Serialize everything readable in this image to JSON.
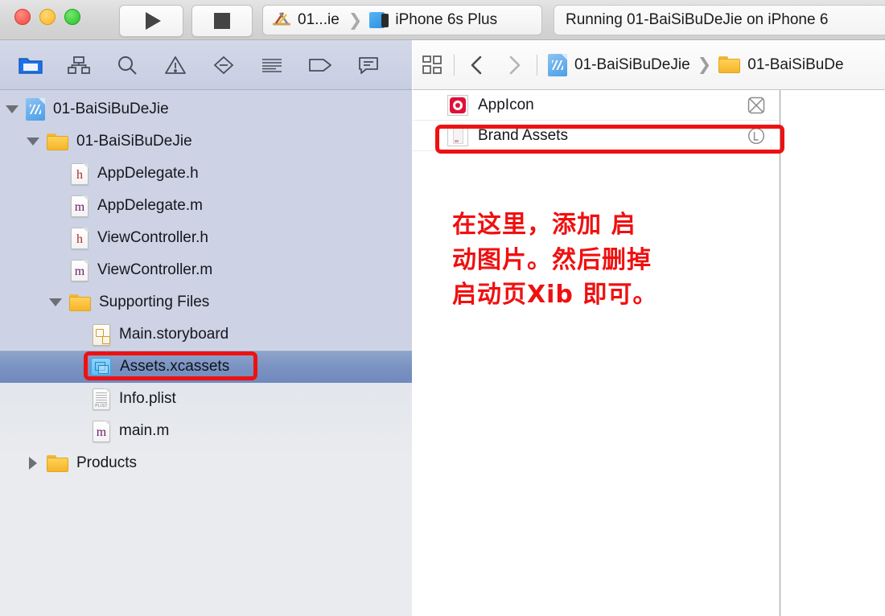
{
  "window": {
    "traffic_lights": [
      "close",
      "minimize",
      "zoom"
    ]
  },
  "toolbar": {
    "run_label": "Run",
    "stop_label": "Stop",
    "scheme": "01...ie",
    "destination": "iPhone 6s Plus",
    "activity_status": "Running 01-BaiSiBuDeJie on iPhone 6"
  },
  "navigator_toolbar": {
    "items": [
      {
        "name": "project-navigator",
        "icon": "folder-icon",
        "selected": true
      },
      {
        "name": "source-control-navigator",
        "icon": "hierarchy-icon",
        "selected": false
      },
      {
        "name": "symbol-navigator",
        "icon": "search-icon",
        "selected": false
      },
      {
        "name": "issue-navigator",
        "icon": "warning-triangle-icon",
        "selected": false
      },
      {
        "name": "test-navigator",
        "icon": "breakpoint-diamond-icon",
        "selected": false
      },
      {
        "name": "debug-navigator",
        "icon": "report-lines-icon",
        "selected": false
      },
      {
        "name": "breakpoint-navigator",
        "icon": "tag-icon",
        "selected": false
      },
      {
        "name": "report-navigator",
        "icon": "speech-bubble-icon",
        "selected": false
      }
    ]
  },
  "editor_toolbar": {
    "grid_icon": "four-squares-icon",
    "back_icon": "chevron-left-icon",
    "forward_icon": "chevron-right-icon",
    "breadcrumb": [
      {
        "label": "01-BaiSiBuDeJie",
        "icon": "project-file-icon"
      },
      {
        "label": "01-BaiSiBuDe",
        "icon": "folder-icon"
      }
    ]
  },
  "navigator": {
    "rows": [
      {
        "label": "01-BaiSiBuDeJie",
        "icon": "project-file-icon",
        "indent": 0,
        "disclosure": "down",
        "selected": false
      },
      {
        "label": "01-BaiSiBuDeJie",
        "icon": "folder-icon",
        "indent": 1,
        "disclosure": "down",
        "selected": false
      },
      {
        "label": "AppDelegate.h",
        "icon": "header-file-icon",
        "indent": 2,
        "disclosure": "none",
        "selected": false
      },
      {
        "label": "AppDelegate.m",
        "icon": "objc-file-icon",
        "indent": 2,
        "disclosure": "none",
        "selected": false
      },
      {
        "label": "ViewController.h",
        "icon": "header-file-icon",
        "indent": 2,
        "disclosure": "none",
        "selected": false
      },
      {
        "label": "ViewController.m",
        "icon": "objc-file-icon",
        "indent": 2,
        "disclosure": "none",
        "selected": false
      },
      {
        "label": "Supporting Files",
        "icon": "folder-icon",
        "indent": 2,
        "disclosure": "down",
        "selected": false
      },
      {
        "label": "Main.storyboard",
        "icon": "storyboard-file-icon",
        "indent": 3,
        "disclosure": "none",
        "selected": false
      },
      {
        "label": "Assets.xcassets",
        "icon": "xcassets-file-icon",
        "indent": 3,
        "disclosure": "none",
        "selected": true
      },
      {
        "label": "Info.plist",
        "icon": "plist-file-icon",
        "indent": 3,
        "disclosure": "none",
        "selected": false
      },
      {
        "label": "main.m",
        "icon": "objc-file-icon",
        "indent": 3,
        "disclosure": "none",
        "selected": false
      },
      {
        "label": "Products",
        "icon": "folder-icon",
        "indent": 1,
        "disclosure": "right",
        "selected": false
      }
    ]
  },
  "asset_catalog": {
    "rows": [
      {
        "label": "AppIcon",
        "thumb": "appicon-thumbnail",
        "badge": "unassigned-square-x-icon",
        "badge_glyph": "x",
        "highlighted": false
      },
      {
        "label": "Brand Assets",
        "thumb": "launch-image-thumbnail",
        "badge": "launch-circle-l-icon",
        "badge_glyph": "L",
        "highlighted": true
      }
    ]
  },
  "annotation": {
    "lines": [
      "在这里，添加 启",
      "动图片。然后删掉",
      "启动页Xib 即可。"
    ],
    "color": "#f01010"
  },
  "highlight_boxes": {
    "color": "#ee1111",
    "targets": [
      "assets-xcassets-row",
      "brand-assets-row"
    ]
  }
}
